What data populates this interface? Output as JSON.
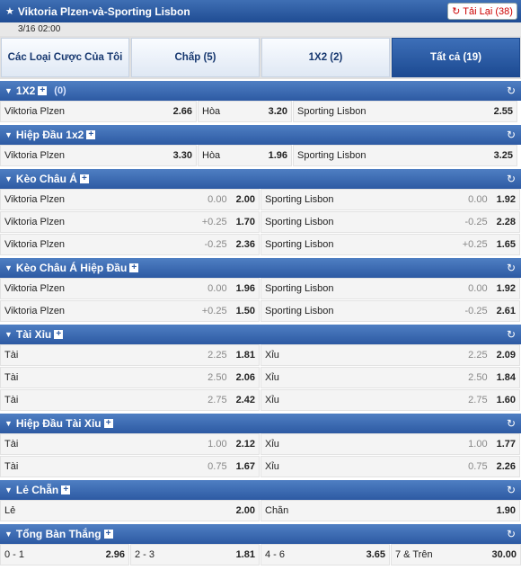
{
  "header": {
    "title": "Viktoria Plzen-và-Sporting Lisbon",
    "reload_label": "Tải Lại (38)",
    "time": "3/16 02:00"
  },
  "tabs": [
    {
      "label": "Các Loại Cược Của Tôi"
    },
    {
      "label": "Chấp (5)"
    },
    {
      "label": "1X2 (2)"
    },
    {
      "label": "Tất cả (19)"
    }
  ],
  "sections": [
    {
      "name": "1X2",
      "count": "(0)",
      "cols": [
        219,
        105,
        250
      ],
      "rows": [
        [
          {
            "label": "Viktoria Plzen",
            "odd": "2.66"
          },
          {
            "label": "Hòa",
            "odd": "3.20"
          },
          {
            "label": "Sporting Lisbon",
            "odd": "2.55"
          }
        ]
      ]
    },
    {
      "name": "Hiệp Đầu 1x2",
      "cols": [
        219,
        105,
        250
      ],
      "rows": [
        [
          {
            "label": "Viktoria Plzen",
            "odd": "3.30"
          },
          {
            "label": "Hòa",
            "odd": "1.96"
          },
          {
            "label": "Sporting Lisbon",
            "odd": "3.25"
          }
        ]
      ]
    },
    {
      "name": "Kèo Châu Á",
      "cols": [
        289,
        289
      ],
      "rows": [
        [
          {
            "label": "Viktoria Plzen",
            "hc": "0.00",
            "odd": "2.00"
          },
          {
            "label": "Sporting Lisbon",
            "hc": "0.00",
            "odd": "1.92"
          }
        ],
        [
          {
            "label": "Viktoria Plzen",
            "hc": "+0.25",
            "odd": "1.70"
          },
          {
            "label": "Sporting Lisbon",
            "hc": "-0.25",
            "odd": "2.28"
          }
        ],
        [
          {
            "label": "Viktoria Plzen",
            "hc": "-0.25",
            "odd": "2.36"
          },
          {
            "label": "Sporting Lisbon",
            "hc": "+0.25",
            "odd": "1.65"
          }
        ]
      ]
    },
    {
      "name": "Kèo Châu Á Hiệp Đầu",
      "cols": [
        289,
        289
      ],
      "rows": [
        [
          {
            "label": "Viktoria Plzen",
            "hc": "0.00",
            "odd": "1.96"
          },
          {
            "label": "Sporting Lisbon",
            "hc": "0.00",
            "odd": "1.92"
          }
        ],
        [
          {
            "label": "Viktoria Plzen",
            "hc": "+0.25",
            "odd": "1.50"
          },
          {
            "label": "Sporting Lisbon",
            "hc": "-0.25",
            "odd": "2.61"
          }
        ]
      ]
    },
    {
      "name": "Tài Xỉu",
      "cols": [
        289,
        289
      ],
      "rows": [
        [
          {
            "label": "Tài",
            "hc": "2.25",
            "odd": "1.81"
          },
          {
            "label": "Xỉu",
            "hc": "2.25",
            "odd": "2.09"
          }
        ],
        [
          {
            "label": "Tài",
            "hc": "2.50",
            "odd": "2.06"
          },
          {
            "label": "Xỉu",
            "hc": "2.50",
            "odd": "1.84"
          }
        ],
        [
          {
            "label": "Tài",
            "hc": "2.75",
            "odd": "2.42"
          },
          {
            "label": "Xỉu",
            "hc": "2.75",
            "odd": "1.60"
          }
        ]
      ]
    },
    {
      "name": "Hiệp Đầu Tài Xỉu",
      "cols": [
        289,
        289
      ],
      "rows": [
        [
          {
            "label": "Tài",
            "hc": "1.00",
            "odd": "2.12"
          },
          {
            "label": "Xỉu",
            "hc": "1.00",
            "odd": "1.77"
          }
        ],
        [
          {
            "label": "Tài",
            "hc": "0.75",
            "odd": "1.67"
          },
          {
            "label": "Xỉu",
            "hc": "0.75",
            "odd": "2.26"
          }
        ]
      ]
    },
    {
      "name": "Lẻ Chẵn",
      "cols": [
        289,
        289
      ],
      "rows": [
        [
          {
            "label": "Lẻ",
            "odd": "2.00"
          },
          {
            "label": "Chẵn",
            "odd": "1.90"
          }
        ]
      ]
    },
    {
      "name": "Tổng Bàn Thắng",
      "cols": [
        144,
        144,
        144,
        145
      ],
      "rows": [
        [
          {
            "label": "0 - 1",
            "odd": "2.96"
          },
          {
            "label": "2 - 3",
            "odd": "1.81"
          },
          {
            "label": "4 - 6",
            "odd": "3.65"
          },
          {
            "label": "7 & Trên",
            "odd": "30.00"
          }
        ]
      ]
    }
  ]
}
